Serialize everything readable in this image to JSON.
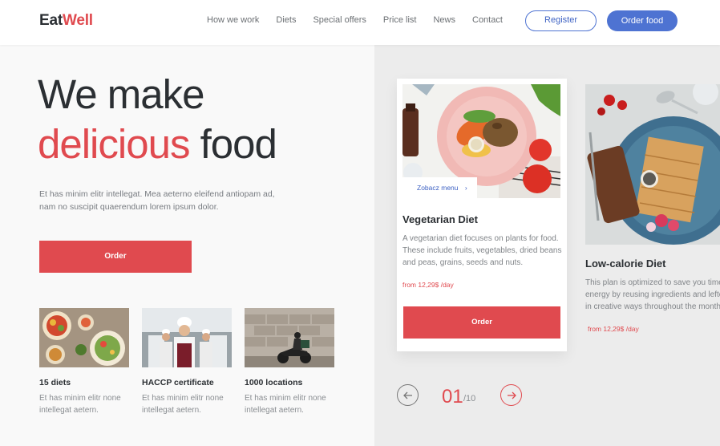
{
  "brand": {
    "part1": "Eat",
    "part2": "Well"
  },
  "nav": {
    "items": [
      "How we work",
      "Diets",
      "Special offers",
      "Price list",
      "News",
      "Contact"
    ]
  },
  "header": {
    "register": "Register",
    "order_food": "Order food"
  },
  "hero": {
    "line1": "We make",
    "line2_red": "delicious",
    "line2_dark": " food",
    "paragraph": "Et has minim elitr intellegat. Mea aeterno eleifend antiopam ad, nam no suscipit quaerendum lorem ipsum dolor.",
    "order_label": "Order"
  },
  "features": [
    {
      "title": "15 diets",
      "desc": "Et has minim elitr none intellegat aetern."
    },
    {
      "title": "HACCP certificate",
      "desc": "Et has minim elitr none intellegat aetern."
    },
    {
      "title": "1000 locations",
      "desc": "Et has minim elitr none intellegat aetern."
    }
  ],
  "cards": [
    {
      "title": "Vegetarian Diet",
      "see_menu": "Zobacz menu",
      "desc": "A vegetarian diet focuses on plants for food. These include fruits, vegetables, dried beans and peas, grains, seeds and nuts.",
      "price": "from 12,29$ /day",
      "button": "Order"
    },
    {
      "title": "Low-calorie Diet",
      "desc": "This plan is optimized to save you time and energy by reusing ingredients and leftovers in creative ways throughout the month.",
      "price": "from 12,29$ /day"
    }
  ],
  "pager": {
    "current": "01",
    "total": "/10"
  },
  "colors": {
    "accent_red": "#e04a4f",
    "accent_blue": "#4e73d2",
    "text_dark": "#2b2f33"
  }
}
